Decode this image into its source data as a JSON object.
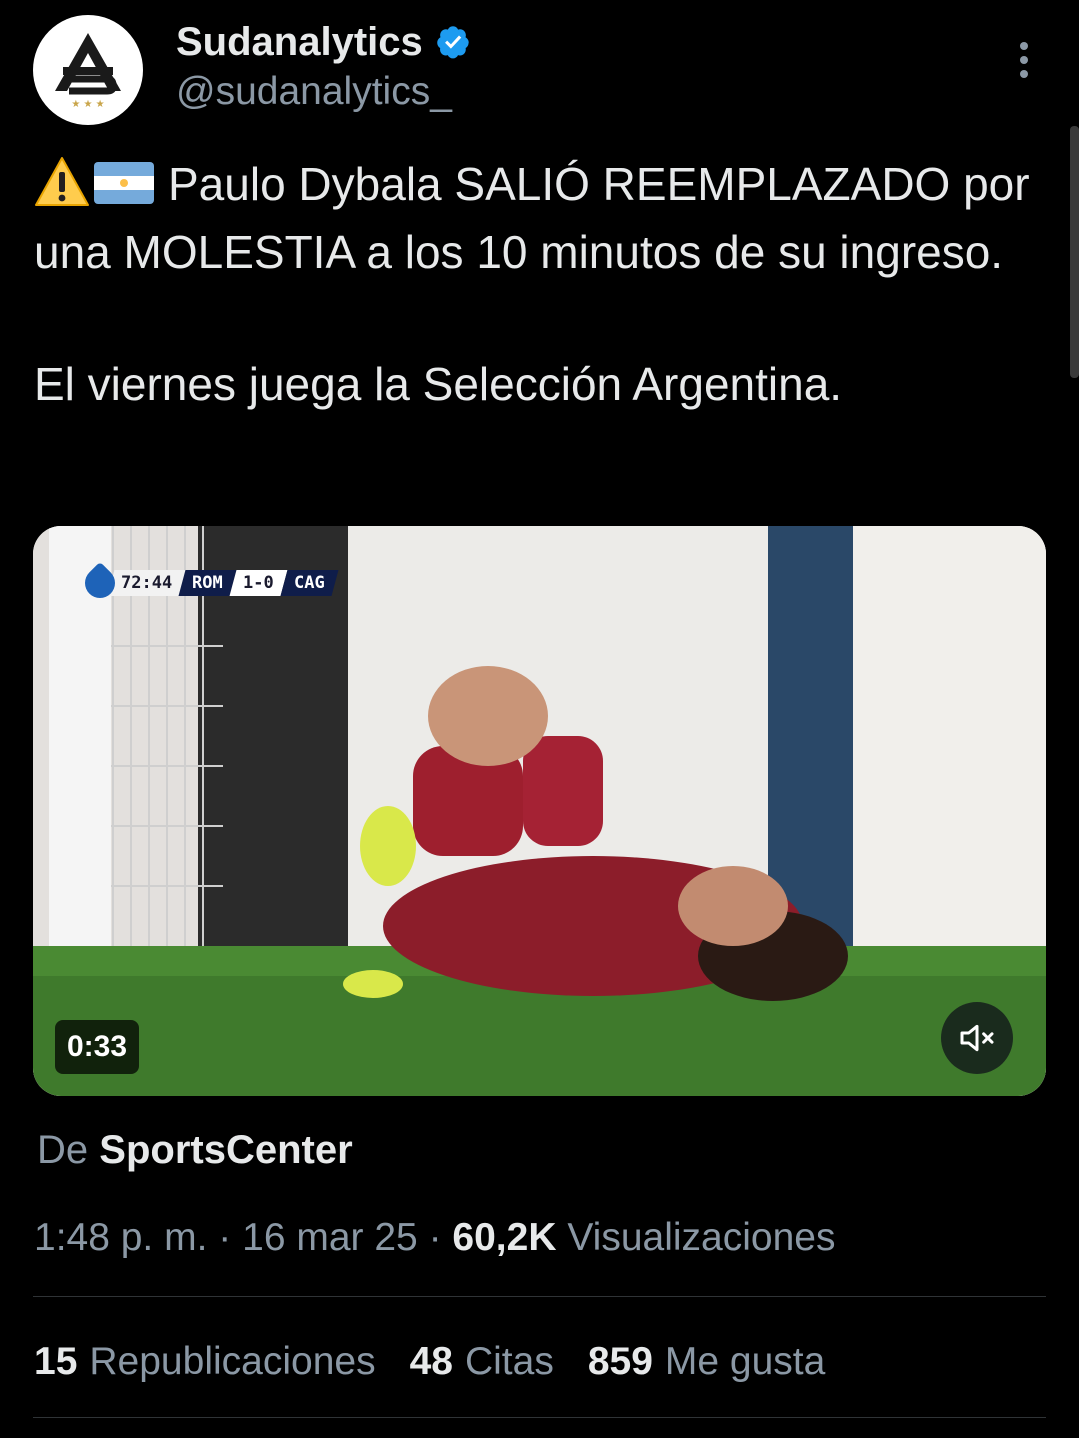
{
  "author": {
    "display_name": "Sudanalytics",
    "handle": "@sudanalytics_",
    "verified": true,
    "avatar_icon": "sudanalytics-logo",
    "accent_color": "#1d9bf0"
  },
  "tweet": {
    "line1_emojis": [
      "warning-emoji",
      "argentina-flag-emoji"
    ],
    "paragraph1": "Paulo Dybala SALIÓ REEMPLAZADO por una MOLESTIA a los 10 minutos de su ingreso.",
    "paragraph2": "El viernes juega la Selección Argentina."
  },
  "media": {
    "type": "video",
    "scorebug": {
      "clock": "72:44",
      "home": "ROM",
      "score": "1-0",
      "away": "CAG"
    },
    "duration": "0:33",
    "mute_icon": "speaker-muted-icon"
  },
  "attribution": {
    "prefix": "De",
    "source": "SportsCenter"
  },
  "meta": {
    "time": "1:48 p. m.",
    "separator": "·",
    "date": "16 mar 25",
    "views_count": "60,2K",
    "views_label": "Visualizaciones"
  },
  "stats": {
    "reposts": {
      "count": "15",
      "label": "Republicaciones"
    },
    "quotes": {
      "count": "48",
      "label": "Citas"
    },
    "likes": {
      "count": "859",
      "label": "Me gusta"
    }
  },
  "colors": {
    "background": "#000000",
    "text_primary": "#e7e9ea",
    "text_secondary": "#8b98a5",
    "divider": "#2f3336"
  }
}
